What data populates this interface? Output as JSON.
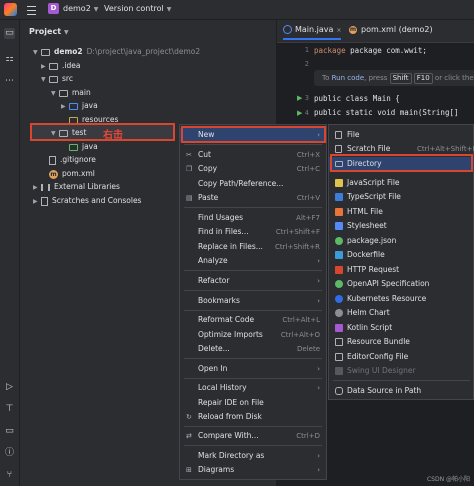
{
  "topbar": {
    "project_badge": "D",
    "project_name": "demo2",
    "vcs": "Version control"
  },
  "panel": {
    "title": "Project"
  },
  "tree": [
    {
      "label": "demo2",
      "path": "D:\\project\\java_project\\demo2"
    },
    {
      "label": ".idea"
    },
    {
      "label": "src"
    },
    {
      "label": "main"
    },
    {
      "label": "java"
    },
    {
      "label": "resources"
    },
    {
      "label": "test"
    },
    {
      "label": "java"
    },
    {
      "label": ".gitignore"
    },
    {
      "label": "pom.xml"
    },
    {
      "label": "External Libraries"
    },
    {
      "label": "Scratches and Consoles"
    }
  ],
  "annotation": "右击",
  "editor": {
    "tabs": [
      "Main.java",
      "pom.xml (demo2)"
    ],
    "lines": [
      "1",
      "2",
      "3",
      "4",
      "5",
      "6"
    ],
    "code": {
      "pkg": "package com.wwit;",
      "hint_prefix": "To ",
      "hint_run": "Run code",
      "hint_mid": ", press ",
      "hint_key1": "Shift",
      "hint_key2": "F10",
      "hint_tail": " or click the",
      "class_line": "public class Main {",
      "main_line": "    public static void main(String[]"
    }
  },
  "context_menu": [
    {
      "label": "New",
      "shortcut": "",
      "submenu": true
    },
    {
      "label": "Cut",
      "shortcut": "Ctrl+X"
    },
    {
      "label": "Copy",
      "shortcut": "Ctrl+C"
    },
    {
      "label": "Copy Path/Reference...",
      "shortcut": ""
    },
    {
      "label": "Paste",
      "shortcut": "Ctrl+V"
    },
    {
      "label": "Find Usages",
      "shortcut": "Alt+F7"
    },
    {
      "label": "Find in Files...",
      "shortcut": "Ctrl+Shift+F"
    },
    {
      "label": "Replace in Files...",
      "shortcut": "Ctrl+Shift+R"
    },
    {
      "label": "Analyze",
      "shortcut": "",
      "submenu": true
    },
    {
      "label": "Refactor",
      "shortcut": "",
      "submenu": true
    },
    {
      "label": "Bookmarks",
      "shortcut": "",
      "submenu": true
    },
    {
      "label": "Reformat Code",
      "shortcut": "Ctrl+Alt+L"
    },
    {
      "label": "Optimize Imports",
      "shortcut": "Ctrl+Alt+O"
    },
    {
      "label": "Delete...",
      "shortcut": "Delete"
    },
    {
      "label": "Open In",
      "shortcut": "",
      "submenu": true
    },
    {
      "label": "Local History",
      "shortcut": "",
      "submenu": true
    },
    {
      "label": "Repair IDE on File",
      "shortcut": ""
    },
    {
      "label": "Reload from Disk",
      "shortcut": ""
    },
    {
      "label": "Compare With...",
      "shortcut": "Ctrl+D"
    },
    {
      "label": "Mark Directory as",
      "shortcut": "",
      "submenu": true
    },
    {
      "label": "Diagrams",
      "shortcut": "",
      "submenu": true
    }
  ],
  "submenu": [
    {
      "label": "File",
      "shortcut": "",
      "color": "#aeb1b7"
    },
    {
      "label": "Scratch File",
      "shortcut": "Ctrl+Alt+Shift+Inse",
      "color": "#aeb1b7"
    },
    {
      "label": "Directory",
      "shortcut": "",
      "color": "#aeb1b7"
    },
    {
      "label": "JavaScript File",
      "shortcut": "",
      "color": "#e0c34c"
    },
    {
      "label": "TypeScript File",
      "shortcut": "",
      "color": "#3b7dd8"
    },
    {
      "label": "HTML File",
      "shortcut": "",
      "color": "#e8743b"
    },
    {
      "label": "Stylesheet",
      "shortcut": "",
      "color": "#548af7"
    },
    {
      "label": "package.json",
      "shortcut": "",
      "color": "#5fb865"
    },
    {
      "label": "Dockerfile",
      "shortcut": "",
      "color": "#3b9ad8"
    },
    {
      "label": "HTTP Request",
      "shortcut": "",
      "color": "#d9462f"
    },
    {
      "label": "OpenAPI Specification",
      "shortcut": "",
      "color": "#5fb865"
    },
    {
      "label": "Kubernetes Resource",
      "shortcut": "",
      "color": "#326ce5"
    },
    {
      "label": "Helm Chart",
      "shortcut": "",
      "color": "#8b8e93"
    },
    {
      "label": "Kotlin Script",
      "shortcut": "",
      "color": "#a55ad4"
    },
    {
      "label": "Resource Bundle",
      "shortcut": "",
      "color": "#aeb1b7"
    },
    {
      "label": "EditorConfig File",
      "shortcut": "",
      "color": "#aeb1b7"
    },
    {
      "label": "Swing UI Designer",
      "shortcut": "",
      "color": "#55585d",
      "disabled": true
    },
    {
      "label": "Data Source in Path",
      "shortcut": "",
      "color": "#aeb1b7"
    }
  ],
  "watermark": "CSDN @帕小阳"
}
